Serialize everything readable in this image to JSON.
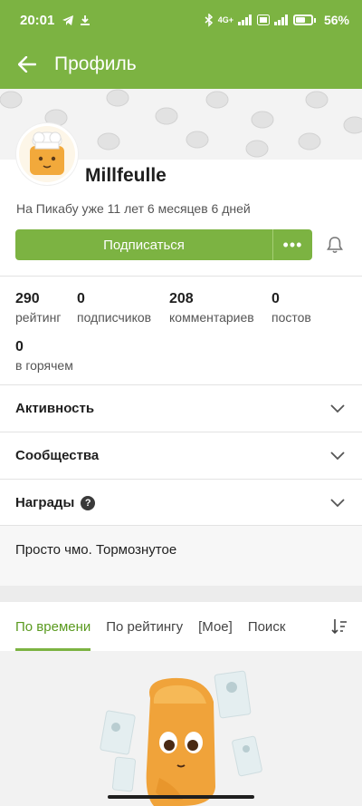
{
  "status_bar": {
    "time": "20:01",
    "network": "4G+",
    "battery_percent": "56%",
    "battery_level": 0.56
  },
  "app_bar": {
    "title": "Профиль"
  },
  "profile": {
    "username": "Millfeulle",
    "since": "На Пикабу уже 11 лет 6 месяцев 6 дней",
    "subscribe_label": "Подписаться",
    "more_label": "•••"
  },
  "stats": [
    {
      "value": "290",
      "label": "рейтинг"
    },
    {
      "value": "0",
      "label": "подписчиков"
    },
    {
      "value": "208",
      "label": "комментариев"
    },
    {
      "value": "0",
      "label": "постов"
    },
    {
      "value": "0",
      "label": "в горячем"
    }
  ],
  "sections": [
    {
      "title": "Активность"
    },
    {
      "title": "Сообщества"
    },
    {
      "title": "Награды",
      "help": "?"
    }
  ],
  "bio": "Просто чмо. Тормознутое",
  "tabs": [
    {
      "label": "По времени",
      "active": true
    },
    {
      "label": "По рейтингу"
    },
    {
      "label": "[Мое]"
    },
    {
      "label": "Поиск"
    }
  ],
  "colors": {
    "accent": "#7cb342",
    "active_tab_text": "#5a9a1f"
  }
}
